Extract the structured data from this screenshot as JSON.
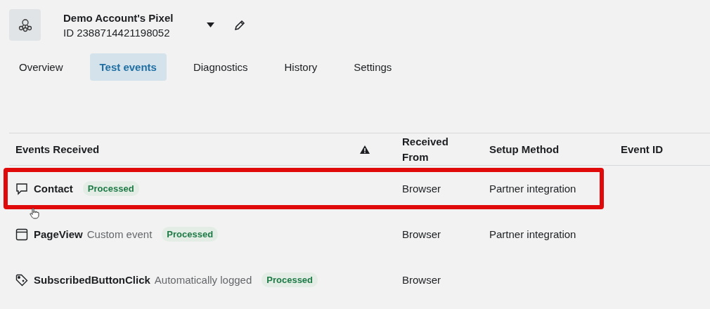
{
  "pixel": {
    "name": "Demo Account's Pixel",
    "id": "ID 2388714421198052"
  },
  "tabs": [
    {
      "label": "Overview",
      "selected": false
    },
    {
      "label": "Test events",
      "selected": true
    },
    {
      "label": "Diagnostics",
      "selected": false
    },
    {
      "label": "History",
      "selected": false
    },
    {
      "label": "Settings",
      "selected": false
    }
  ],
  "table": {
    "columns": [
      "Events Received",
      "Received From",
      "Setup Method",
      "Event ID"
    ],
    "rows": [
      {
        "kind": "message",
        "event": "Contact",
        "status": "Processed",
        "received_from": "Browser",
        "setup_method": "Partner integration",
        "highlighted": true
      },
      {
        "kind": "page",
        "event": "PageView",
        "description": "Custom event",
        "status": "Processed",
        "received_from": "Browser",
        "setup_method": "Partner integration",
        "highlighted": false
      },
      {
        "kind": "tag",
        "event": "SubscribedButtonClick",
        "description": "Automatically logged",
        "status": "Processed",
        "received_from": "Browser",
        "highlighted": false
      }
    ]
  }
}
